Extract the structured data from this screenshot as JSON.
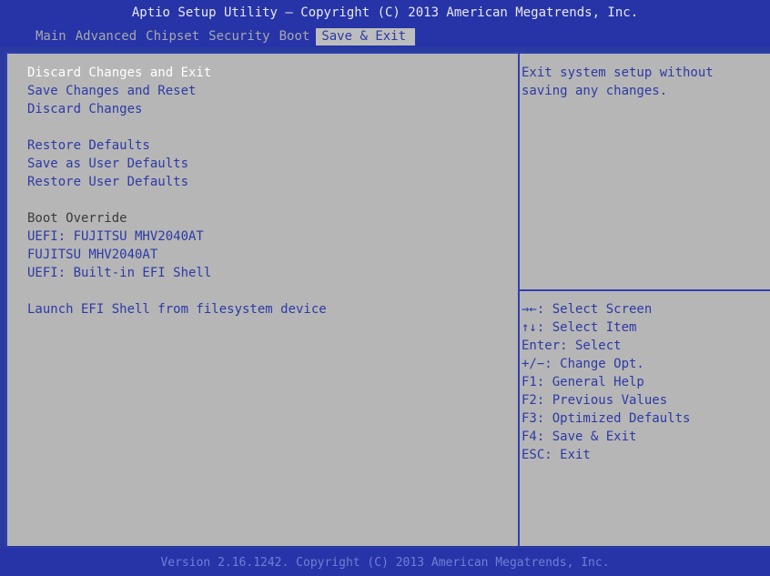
{
  "header": {
    "title": "Aptio Setup Utility – Copyright (C) 2013 American Megatrends, Inc.",
    "tabs": [
      "Main",
      "Advanced",
      "Chipset",
      "Security",
      "Boot",
      "Save & Exit"
    ],
    "active_tab": "Save & Exit"
  },
  "menu": {
    "items": [
      "Discard Changes and Exit",
      "Save Changes and Reset",
      "Discard Changes",
      "Restore Defaults",
      "Save as User Defaults",
      "Restore User Defaults",
      "Boot Override",
      "UEFI: FUJITSU MHV2040AT",
      "FUJITSU MHV2040AT",
      "UEFI: Built-in EFI Shell",
      "Launch EFI Shell from filesystem device"
    ],
    "selected": "Discard Changes and Exit"
  },
  "help": {
    "line1": "Exit system setup without",
    "line2": "saving any changes."
  },
  "keys": [
    "→←: Select Screen",
    "↑↓: Select Item",
    "Enter: Select",
    "+/−: Change Opt.",
    "F1: General Help",
    "F2: Previous Values",
    "F3: Optimized Defaults",
    "F4: Save & Exit",
    "ESC: Exit"
  ],
  "footer": {
    "text": "Version 2.16.1242. Copyright (C) 2013 American Megatrends, Inc."
  },
  "colors": {
    "header_bg": "#2634a8",
    "panel_bg": "#b6b6b6",
    "item_text": "#2d3aa6",
    "selected_text": "#ffffff"
  }
}
